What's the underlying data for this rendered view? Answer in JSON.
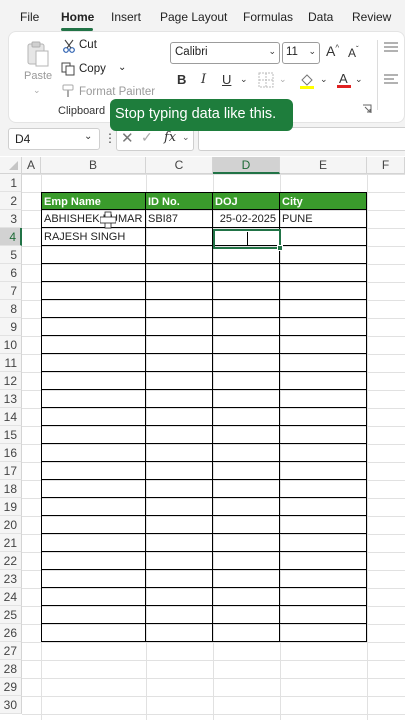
{
  "ribbon_tabs": [
    {
      "label": "File"
    },
    {
      "label": "Home"
    },
    {
      "label": "Insert"
    },
    {
      "label": "Page Layout"
    },
    {
      "label": "Formulas"
    },
    {
      "label": "Data"
    },
    {
      "label": "Review"
    }
  ],
  "active_tab": "Home",
  "clipboard": {
    "paste_label": "Paste",
    "cut_label": "Cut",
    "copy_label": "Copy",
    "format_painter_label": "Format Painter",
    "group_label": "Clipboard"
  },
  "font": {
    "name": "Calibri",
    "size": "11",
    "bold": "B",
    "italic": "I",
    "underline": "U",
    "grow": "A",
    "shrink": "A"
  },
  "tooltip_text": "Stop typing data like this.",
  "formula_bar": {
    "name_box": "D4",
    "fx_label": "fx",
    "value": ""
  },
  "columns": [
    "A",
    "B",
    "C",
    "D",
    "E",
    "F"
  ],
  "rows": [
    "1",
    "2",
    "3",
    "4",
    "5",
    "6",
    "7",
    "8",
    "9",
    "10",
    "11",
    "12",
    "13",
    "14",
    "15",
    "16",
    "17",
    "18",
    "19",
    "20",
    "21",
    "22",
    "23",
    "24",
    "25",
    "26",
    "27",
    "28",
    "29",
    "30"
  ],
  "selected_column": "D",
  "selected_row": "4",
  "table": {
    "headers": [
      "Emp Name",
      "ID No.",
      "DOJ",
      "City"
    ],
    "rows": [
      [
        "ABHISHEK KUMAR",
        "SBI87",
        "25-02-2025",
        "PUNE"
      ],
      [
        "RAJESH SINGH",
        "",
        "",
        ""
      ]
    ]
  },
  "colors": {
    "accent": "#217346",
    "header_fill": "#3a9b2c",
    "tooltip_bg": "#1e7d3c",
    "font_color_bar": "#e02020",
    "highlight_bar": "#ffff00"
  }
}
